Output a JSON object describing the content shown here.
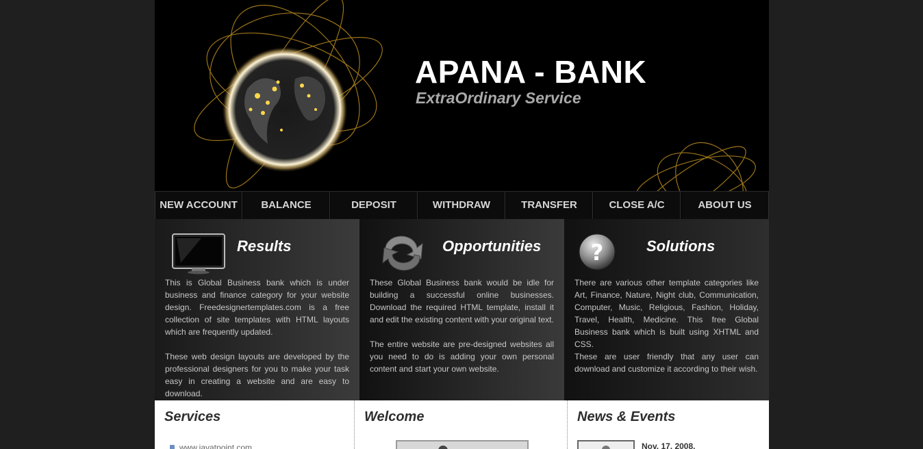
{
  "header": {
    "title": "APANA - BANK",
    "tagline": "ExtraOrdinary Service"
  },
  "nav": {
    "items": [
      "NEW ACCOUNT",
      "BALANCE",
      "DEPOSIT",
      "WITHDRAW",
      "TRANSFER",
      "CLOSE A/C",
      "ABOUT US"
    ]
  },
  "features": [
    {
      "title": "Results",
      "icon": "monitor-icon",
      "paragraphs": [
        "This is Global Business bank which is under business and finance category for your website design. Freedesignertemplates.com is a free collection of site templates with HTML layouts which are frequently updated.",
        "These web design layouts are developed by the professional designers for you to make your task easy in creating a website and are easy to download."
      ]
    },
    {
      "title": "Opportunities",
      "icon": "refresh-arrows-icon",
      "paragraphs": [
        "These Global Business bank would be idle for building a successful online businesses. Download the required HTML template, install it and edit the existing content with your original text.",
        "The entire website are pre-designed websites all you need to do is adding your own personal content and start your own website."
      ]
    },
    {
      "title": "Solutions",
      "icon": "help-question-icon",
      "paragraphs": [
        "There are various other template categories like Art, Finance, Nature, Night club, Communication, Computer, Music, Religious, Fashion, Holiday, Travel, Health, Medicine. This free Global Business bank which is built using XHTML and CSS.",
        "These are user friendly that any user can download and customize it according to their wish."
      ]
    }
  ],
  "services": {
    "title": "Services",
    "links": [
      "www.javatpoint.com"
    ]
  },
  "welcome": {
    "title": "Welcome"
  },
  "news": {
    "title": "News & Events",
    "date": "Nov. 17, 2008."
  }
}
